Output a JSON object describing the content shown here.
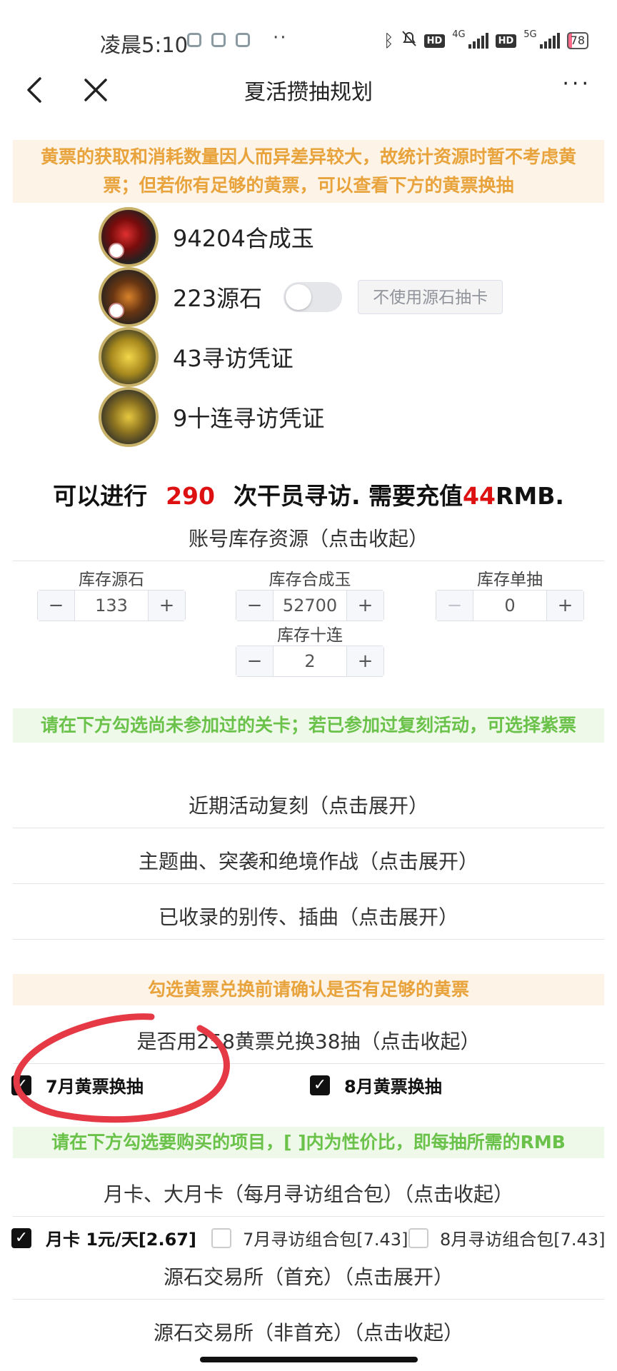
{
  "status_bar": {
    "time": "凌晨5:10",
    "dots": "··",
    "network_1": "4G",
    "network_2": "5G",
    "hd_1": "HD",
    "hd_2": "HD",
    "battery": "78"
  },
  "nav": {
    "title": "夏活攒抽规划",
    "more": "···"
  },
  "notice_yellow_ticket": "黄票的获取和消耗数量因人而异差异较大，故统计资源时暂不考虑黄票；但若你有足够的黄票，可以查看下方的黄票换抽",
  "resources": [
    {
      "label": "94204合成玉",
      "icon": "orundum-icon"
    },
    {
      "label": "223源石",
      "icon": "originite-icon"
    },
    {
      "label": "43寻访凭证",
      "icon": "headhunting-permit-icon"
    },
    {
      "label": "9十连寻访凭证",
      "icon": "ten-roll-permit-icon"
    }
  ],
  "originite_toggle_button": "不使用源石抽卡",
  "summary": {
    "prefix": "可以进行",
    "pulls": "290",
    "middle": "次干员寻访. 需要充值",
    "rmb": "44",
    "suffix": "RMB."
  },
  "inventory": {
    "header": "账号库存资源（点击收起）",
    "fields": [
      {
        "label": "库存源石",
        "value": "133"
      },
      {
        "label": "库存合成玉",
        "value": "52700"
      },
      {
        "label": "库存单抽",
        "value": "0"
      },
      {
        "label": "库存十连",
        "value": "2"
      }
    ],
    "minus": "−",
    "plus": "+"
  },
  "notice_stages": "请在下方勾选尚未参加过的关卡；若已参加过复刻活动，可选择紫票",
  "sections": {
    "reruns": "近期活动复刻（点击展开）",
    "main_story": "主题曲、突袭和绝境作战（点击展开）",
    "side_stories": "已收录的别传、插曲（点击展开）"
  },
  "notice_confirm_tickets": "勾选黄票兑换前请确认是否有足够的黄票",
  "ticket_exchange": {
    "header": "是否用258黄票兑换38抽（点击收起）",
    "july": "7月黄票换抽",
    "august": "8月黄票换抽",
    "july_checked": true,
    "august_checked": true
  },
  "notice_purchase": "请在下方勾选要购买的项目，[ ]内为性价比，即每抽所需的RMB",
  "monthly": {
    "header": "月卡、大月卡（每月寻访组合包）（点击收起）",
    "monthly_card": "月卡 1元/天[2.67]",
    "july_pack": "7月寻访组合包[7.43]",
    "august_pack": "8月寻访组合包[7.43]",
    "monthly_card_checked": true,
    "july_pack_checked": false,
    "august_pack_checked": false
  },
  "exchange_first": "源石交易所（首充）（点击展开）",
  "exchange_nonfirst": "源石交易所（非首充）（点击收起）",
  "check_mark": "✓",
  "colors": {
    "accent_orange": "#e8a33c",
    "accent_green": "#6bc24a",
    "highlight_red": "#d11111",
    "annotation_red": "#e63946"
  }
}
